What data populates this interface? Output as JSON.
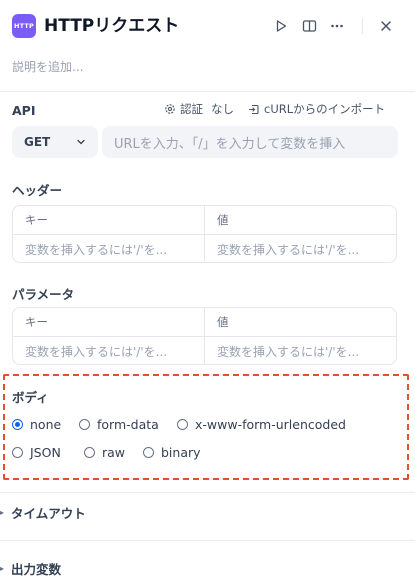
{
  "header": {
    "app_icon_text": "HTTP",
    "title": "HTTPリクエスト",
    "description_placeholder": "説明を追加..."
  },
  "api": {
    "label": "API",
    "auth_label": "認証",
    "auth_value": "なし",
    "curl_import_label": "cURLからのインポート",
    "method": "GET",
    "url_placeholder": "URLを入力、「/」を入力して変数を挿入"
  },
  "headers": {
    "label": "ヘッダー",
    "columns": [
      "キー",
      "値"
    ],
    "row_placeholders": [
      "変数を挿入するには'/'を...",
      "変数を挿入するには'/'を..."
    ]
  },
  "params": {
    "label": "パラメータ",
    "columns": [
      "キー",
      "値"
    ],
    "row_placeholders": [
      "変数を挿入するには'/'を...",
      "変数を挿入するには'/'を..."
    ]
  },
  "body": {
    "label": "ボディ",
    "options": [
      "none",
      "form-data",
      "x-www-form-urlencoded",
      "JSON",
      "raw",
      "binary"
    ],
    "selected": "none"
  },
  "timeout": {
    "label": "タイムアウト"
  },
  "output_vars": {
    "label": "出力変数"
  },
  "colors": {
    "accent": "#155eef",
    "app_icon": "#7c5cf6",
    "highlight": "#e0502a"
  }
}
